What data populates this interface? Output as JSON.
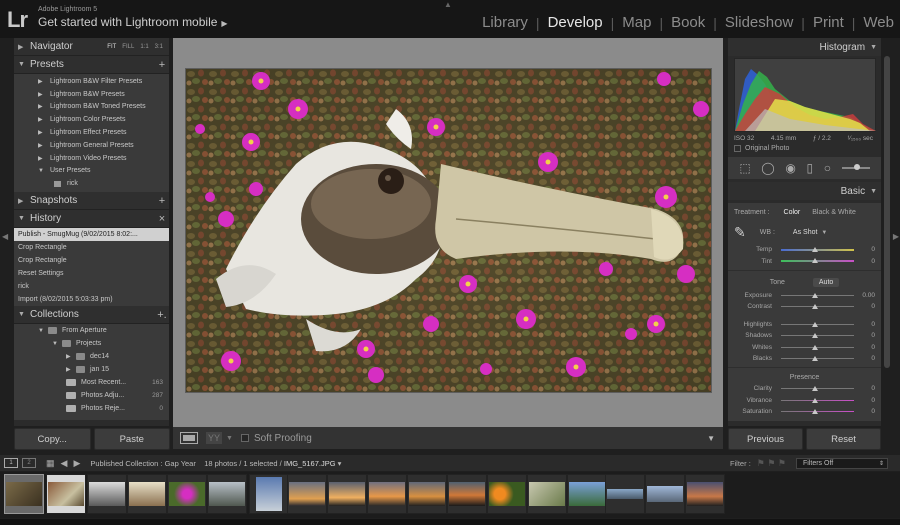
{
  "app": {
    "logo": "Lr",
    "name": "Adobe Lightroom 5",
    "identity_text": "Get started with Lightroom mobile",
    "identity_arrow": "▶"
  },
  "modules": [
    {
      "label": "Library",
      "active": false
    },
    {
      "label": "Develop",
      "active": true
    },
    {
      "label": "Map",
      "active": false
    },
    {
      "label": "Book",
      "active": false
    },
    {
      "label": "Slideshow",
      "active": false
    },
    {
      "label": "Print",
      "active": false
    },
    {
      "label": "Web",
      "active": false
    }
  ],
  "left": {
    "navigator": {
      "title": "Navigator",
      "zoom": [
        "FIT",
        "FILL",
        "1:1",
        "3:1"
      ]
    },
    "presets": {
      "title": "Presets",
      "action": "+",
      "items": [
        "Lightroom B&W Filter Presets",
        "Lightroom B&W Presets",
        "Lightroom B&W Toned Presets",
        "Lightroom Color Presets",
        "Lightroom Effect Presets",
        "Lightroom General Presets",
        "Lightroom Video Presets",
        "User Presets"
      ],
      "user_sub": "rick"
    },
    "snapshots": {
      "title": "Snapshots",
      "action": "+"
    },
    "history": {
      "title": "History",
      "action": "×",
      "items": [
        "Publish - SmugMug (9/02/2015 8:02:...",
        "Crop Rectangle",
        "Crop Rectangle",
        "Reset Settings",
        "rick",
        "Import (8/02/2015 5:03:33 pm)"
      ]
    },
    "collections": {
      "title": "Collections",
      "action": "+.",
      "items": [
        {
          "name": "From Aperture",
          "count": ""
        },
        {
          "name": "Projects",
          "count": ""
        },
        {
          "name": "dec14",
          "count": ""
        },
        {
          "name": "jan 15",
          "count": ""
        },
        {
          "name": "Most Recent...",
          "count": "163"
        },
        {
          "name": "Photos Adju...",
          "count": "287"
        },
        {
          "name": "Photos Reje...",
          "count": "0"
        }
      ]
    },
    "buttons": {
      "copy": "Copy...",
      "paste": "Paste"
    }
  },
  "toolbar": {
    "yy": "YY",
    "soft_proofing": "Soft Proofing"
  },
  "right": {
    "histogram": {
      "title": "Histogram",
      "iso": "ISO 32",
      "focal": "4.15 mm",
      "aperture": "ƒ / 2.2",
      "shutter": "¹⁄₁₅₀₀ sec",
      "original_photo": "Original Photo"
    },
    "basic": {
      "title": "Basic",
      "treatment_label": "Treatment :",
      "treatment_color": "Color",
      "treatment_bw": "Black & White",
      "wb_label": "WB :",
      "wb_value": "As Shot",
      "wb_sliders": [
        {
          "label": "Temp",
          "value": "0"
        },
        {
          "label": "Tint",
          "value": "0"
        }
      ],
      "tone_label": "Tone",
      "auto_label": "Auto",
      "tone_sliders": [
        {
          "label": "Exposure",
          "value": "0.00"
        },
        {
          "label": "Contrast",
          "value": "0"
        }
      ],
      "tone_sliders2": [
        {
          "label": "Highlights",
          "value": "0"
        },
        {
          "label": "Shadows",
          "value": "0"
        },
        {
          "label": "Whites",
          "value": "0"
        },
        {
          "label": "Blacks",
          "value": "0"
        }
      ],
      "presence_label": "Presence",
      "presence_sliders": [
        {
          "label": "Clarity",
          "value": "0"
        },
        {
          "label": "Vibrance",
          "value": "0"
        },
        {
          "label": "Saturation",
          "value": "0"
        }
      ]
    },
    "buttons": {
      "previous": "Previous",
      "reset": "Reset"
    }
  },
  "filmbar": {
    "monitor1": "1",
    "monitor2": "2",
    "source_prefix": "Published Collection : Gap Year",
    "source_count": "18 photos / 1 selected /",
    "source_file": "IMG_5167.JPG",
    "filter_label": "Filter :",
    "filter_value": "Filters Off"
  },
  "filmstrip": {
    "count": 18
  }
}
